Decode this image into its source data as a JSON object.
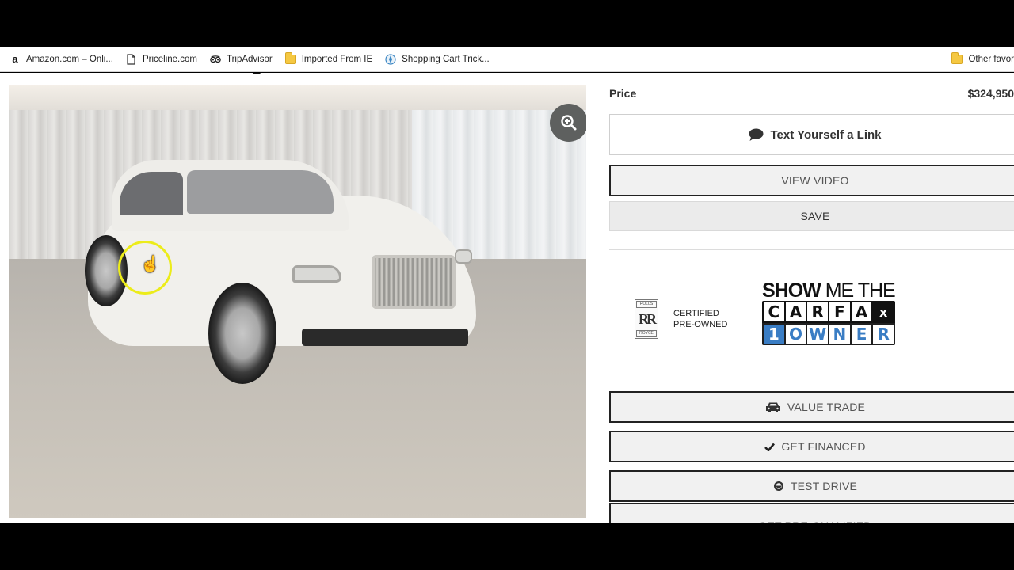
{
  "bookmarks": [
    {
      "label": "Amazon.com – Onli...",
      "icon": "amazon-icon"
    },
    {
      "label": "Priceline.com",
      "icon": "page-icon"
    },
    {
      "label": "TripAdvisor",
      "icon": "tripadvisor-icon"
    },
    {
      "label": "Imported From IE",
      "icon": "folder-icon"
    },
    {
      "label": "Shopping Cart Trick...",
      "icon": "globe-icon"
    }
  ],
  "other_bookmarks": {
    "label": "Other favor",
    "icon": "folder-icon"
  },
  "gallery": {
    "image_alt": "White Rolls-Royce Ghost sedan in showroom",
    "zoom_icon": "zoom-in-icon"
  },
  "vehicle": {
    "price_label": "Price",
    "price_value": "$324,950"
  },
  "actions": {
    "text_link": "Text Yourself a Link",
    "view_video": "VIEW VIDEO",
    "save": "SAVE",
    "value_trade": "VALUE TRADE",
    "get_financed": "GET FINANCED",
    "test_drive": "TEST DRIVE",
    "get_prequalified": "GET PRE-QUALIFIED"
  },
  "badges": {
    "rr_top": "ROLLS",
    "rr_monogram": "RR",
    "rr_bottom": "ROYCE",
    "rr_line1": "CERTIFIED",
    "rr_line2": "PRE-OWNED",
    "carfax_show": "SHOW",
    "carfax_me_the": " ME THE",
    "carfax_letters": [
      "C",
      "A",
      "R",
      "F",
      "A",
      "x"
    ],
    "owner_letters": [
      "1",
      "O",
      "W",
      "N",
      "E",
      "R"
    ]
  },
  "colors": {
    "carfax_blue": "#3a7dc4",
    "cursor_ring": "#ecec1a"
  }
}
